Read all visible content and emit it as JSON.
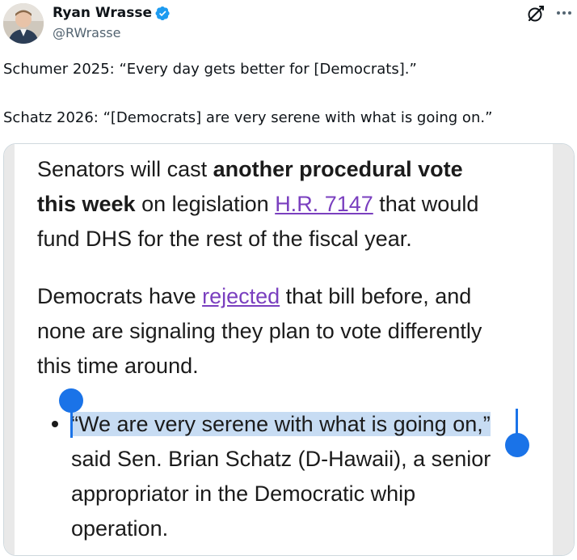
{
  "author": {
    "display_name": "Ryan Wrasse",
    "handle": "@RWrasse",
    "verified": true,
    "verified_color": "#1d9bf0"
  },
  "header_icons": {
    "grok": "grok-icon",
    "more": "more-options-icon"
  },
  "tweet": {
    "line1": "Schumer 2025: “Every day gets better for [Democrats].”",
    "line2": "Schatz 2026: “[Democrats] are very serene with what is going on.”"
  },
  "media": {
    "p1": {
      "t1": "Senators will cast ",
      "b1": "another procedural vote",
      "b2": "this week",
      "t2": " on legislation ",
      "link": "H.R. 7147",
      "t3": " that would",
      "line3": "fund DHS for the rest of the fiscal year."
    },
    "p2": {
      "t1": "Democrats have ",
      "link": "rejected",
      "t2": " that bill before, and",
      "line2": "none are signaling they plan to vote differently",
      "line3": "this time around."
    },
    "bullet": {
      "quote": "“We are very serene with what is going on,”",
      "line2": "said Sen. Brian Schatz (D-Hawaii), a senior",
      "line3": "appropriator in the Democratic whip",
      "line4": "operation."
    },
    "link_color": "#7a3fbf",
    "selection_color": "#1a73e8",
    "highlight_color": "#c7dcf3"
  }
}
